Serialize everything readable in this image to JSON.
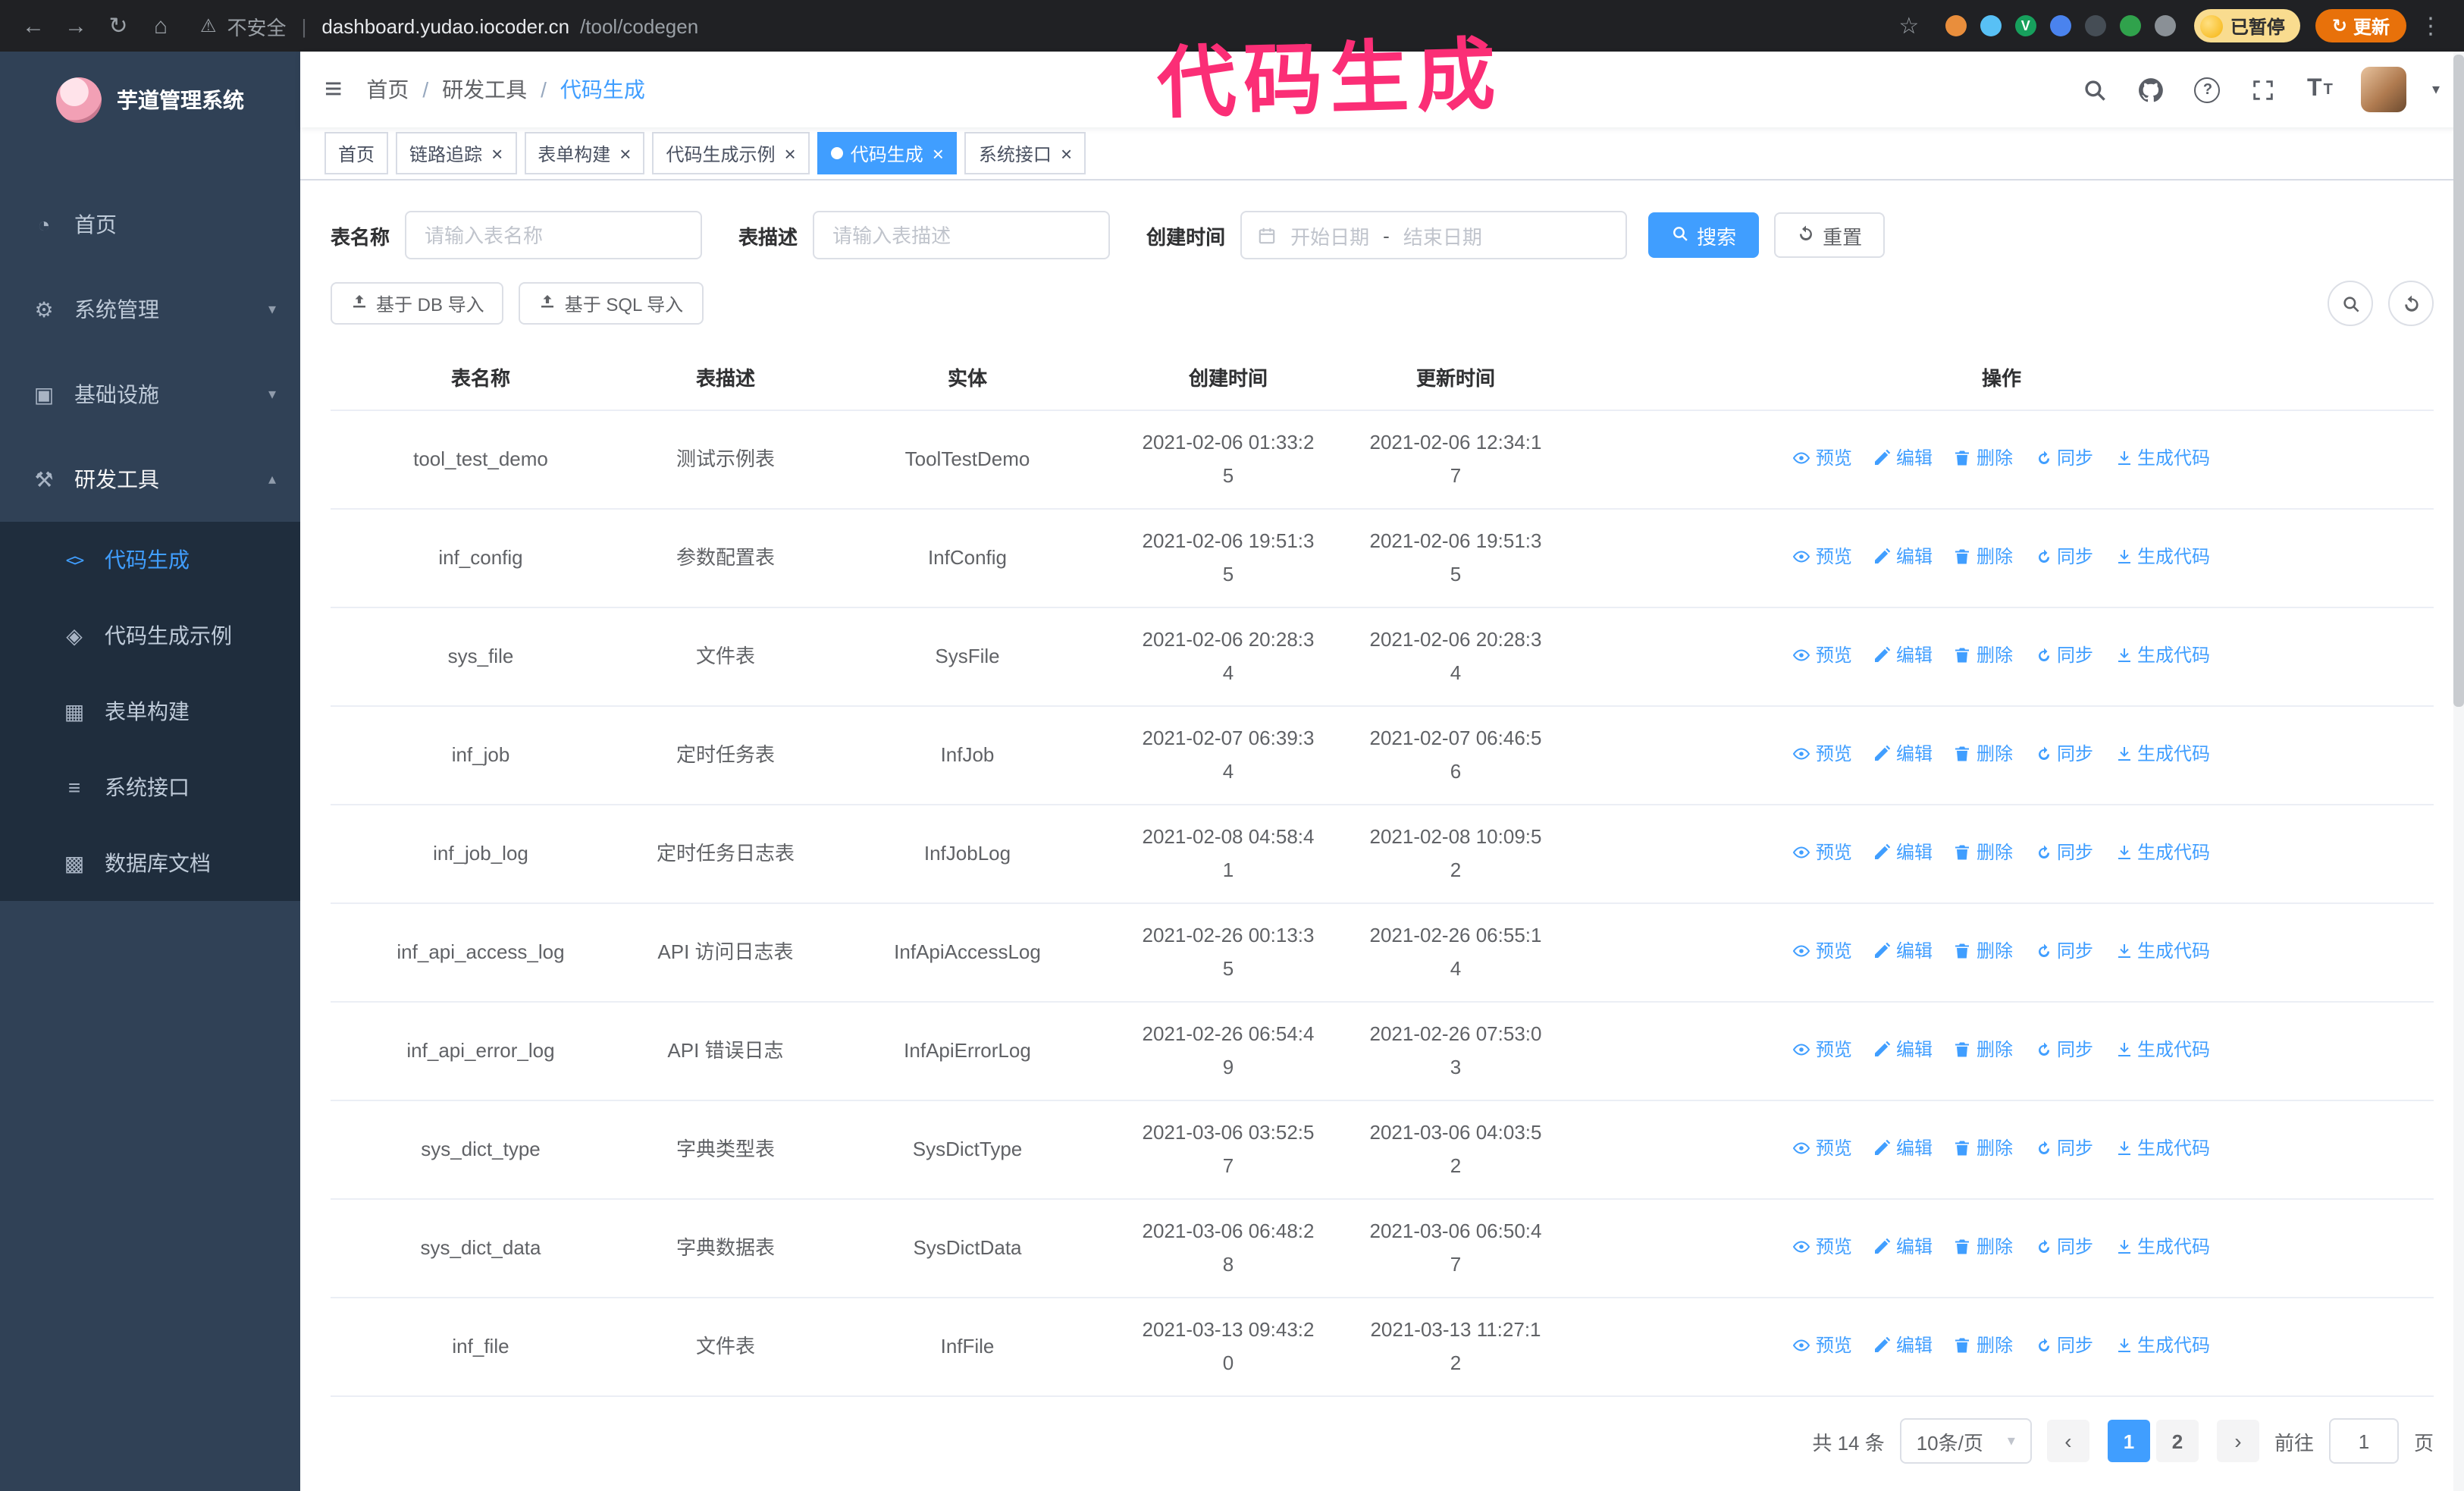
{
  "browser": {
    "security_label": "不安全",
    "url_domain": "dashboard.yudao.iocoder.cn",
    "url_path": "/tool/codegen",
    "paused_badge": "已暂停",
    "update_button": "更新",
    "extensions": [
      {
        "name": "browser-extension-icon",
        "color": "#e98e3c",
        "letter": ""
      },
      {
        "name": "browser-extension-icon",
        "color": "#58c0f5",
        "letter": ""
      },
      {
        "name": "browser-extension-icon",
        "color": "#17a05d",
        "letter": "V"
      },
      {
        "name": "browser-extension-icon",
        "color": "#4a83ee",
        "letter": ""
      },
      {
        "name": "browser-extension-icon",
        "color": "#454d55",
        "letter": ""
      },
      {
        "name": "browser-extension-icon",
        "color": "#30a24c",
        "letter": ""
      },
      {
        "name": "browser-extension-icon",
        "color": "#8a9096",
        "letter": ""
      }
    ]
  },
  "annotation": {
    "text": "代码生成",
    "color": "#fb2e76"
  },
  "sidebar": {
    "logo_title": "芋道管理系统",
    "items": [
      {
        "id": "home",
        "label": "首页",
        "icon": "dashboard-icon",
        "group": false
      },
      {
        "id": "system",
        "label": "系统管理",
        "icon": "gear-icon",
        "group": true,
        "expanded": false
      },
      {
        "id": "infra",
        "label": "基础设施",
        "icon": "infrastructure-icon",
        "group": true,
        "expanded": false
      },
      {
        "id": "devtools",
        "label": "研发工具",
        "icon": "tools-icon",
        "group": true,
        "expanded": true,
        "children": [
          {
            "id": "codegen",
            "label": "代码生成",
            "icon": "code-icon",
            "active": true
          },
          {
            "id": "codegen-example",
            "label": "代码生成示例",
            "icon": "example-icon"
          },
          {
            "id": "form-build",
            "label": "表单构建",
            "icon": "form-icon"
          },
          {
            "id": "api",
            "label": "系统接口",
            "icon": "api-icon"
          },
          {
            "id": "db-doc",
            "label": "数据库文档",
            "icon": "database-icon"
          }
        ]
      }
    ]
  },
  "header": {
    "breadcrumb": [
      "首页",
      "研发工具",
      "代码生成"
    ]
  },
  "tabs": [
    {
      "id": "home",
      "label": "首页",
      "closable": false,
      "active": false
    },
    {
      "id": "tracer",
      "label": "链路追踪",
      "closable": true,
      "active": false
    },
    {
      "id": "form-build",
      "label": "表单构建",
      "closable": true,
      "active": false
    },
    {
      "id": "codegen-example",
      "label": "代码生成示例",
      "closable": true,
      "active": false
    },
    {
      "id": "codegen",
      "label": "代码生成",
      "closable": true,
      "active": true
    },
    {
      "id": "api",
      "label": "系统接口",
      "closable": true,
      "active": false
    }
  ],
  "filters": {
    "table_name_label": "表名称",
    "table_name_placeholder": "请输入表名称",
    "table_desc_label": "表描述",
    "table_desc_placeholder": "请输入表描述",
    "create_time_label": "创建时间",
    "date_start_placeholder": "开始日期",
    "date_separator": "-",
    "date_end_placeholder": "结束日期",
    "search_button": "搜索",
    "reset_button": "重置"
  },
  "toolbar": {
    "import_db": "基于 DB 导入",
    "import_sql": "基于 SQL 导入"
  },
  "table": {
    "columns": [
      "表名称",
      "表描述",
      "实体",
      "创建时间",
      "更新时间",
      "操作"
    ],
    "actions": [
      "预览",
      "编辑",
      "删除",
      "同步",
      "生成代码"
    ],
    "rows": [
      {
        "name": "tool_test_demo",
        "desc": "测试示例表",
        "entity": "ToolTestDemo",
        "created": "2021-02-06 01:33:25",
        "updated": "2021-02-06 12:34:17"
      },
      {
        "name": "inf_config",
        "desc": "参数配置表",
        "entity": "InfConfig",
        "created": "2021-02-06 19:51:35",
        "updated": "2021-02-06 19:51:35"
      },
      {
        "name": "sys_file",
        "desc": "文件表",
        "entity": "SysFile",
        "created": "2021-02-06 20:28:34",
        "updated": "2021-02-06 20:28:34"
      },
      {
        "name": "inf_job",
        "desc": "定时任务表",
        "entity": "InfJob",
        "created": "2021-02-07 06:39:34",
        "updated": "2021-02-07 06:46:56"
      },
      {
        "name": "inf_job_log",
        "desc": "定时任务日志表",
        "entity": "InfJobLog",
        "created": "2021-02-08 04:58:41",
        "updated": "2021-02-08 10:09:52"
      },
      {
        "name": "inf_api_access_log",
        "desc": "API 访问日志表",
        "entity": "InfApiAccessLog",
        "created": "2021-02-26 00:13:35",
        "updated": "2021-02-26 06:55:14"
      },
      {
        "name": "inf_api_error_log",
        "desc": "API 错误日志",
        "entity": "InfApiErrorLog",
        "created": "2021-02-26 06:54:49",
        "updated": "2021-02-26 07:53:03"
      },
      {
        "name": "sys_dict_type",
        "desc": "字典类型表",
        "entity": "SysDictType",
        "created": "2021-03-06 03:52:57",
        "updated": "2021-03-06 04:03:52"
      },
      {
        "name": "sys_dict_data",
        "desc": "字典数据表",
        "entity": "SysDictData",
        "created": "2021-03-06 06:48:28",
        "updated": "2021-03-06 06:50:47"
      },
      {
        "name": "inf_file",
        "desc": "文件表",
        "entity": "InfFile",
        "created": "2021-03-13 09:43:20",
        "updated": "2021-03-13 11:27:12"
      }
    ]
  },
  "pagination": {
    "total": "共 14 条",
    "page_size": "10条/页",
    "pages": [
      "1",
      "2"
    ],
    "active_page": "1",
    "goto_label": "前往",
    "goto_value": "1",
    "goto_suffix": "页"
  },
  "colors": {
    "accent": "#409eff",
    "sidebar_bg": "#304156",
    "submenu_bg": "#1f2d3d",
    "annotation_pink": "#fb2e76",
    "update_orange": "#e8710a",
    "browser_bar": "#202124"
  }
}
